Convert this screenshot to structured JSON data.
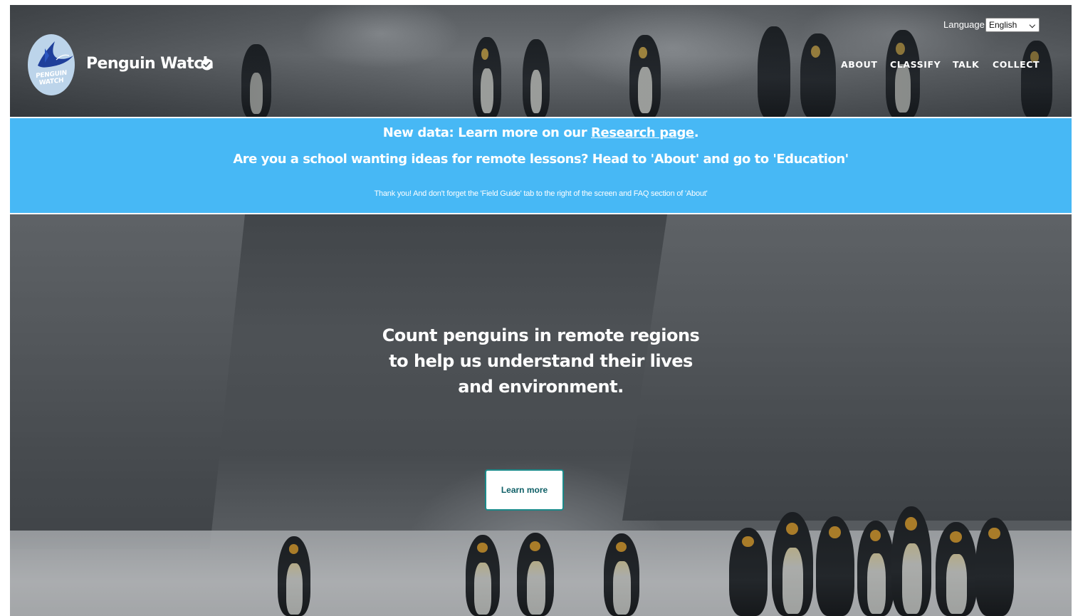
{
  "header": {
    "brand_name": "Penguin Watch",
    "logo_text_line1": "PENGUIN",
    "logo_text_line2": "WATCH",
    "language_label": "Language",
    "language_selected": "English",
    "nav": [
      {
        "label": "ABOUT"
      },
      {
        "label": "CLASSIFY"
      },
      {
        "label": "TALK"
      },
      {
        "label": "COLLECT"
      }
    ]
  },
  "announcement": {
    "line1_prefix": "New data: Learn more on our ",
    "line1_link": "Research page",
    "line1_suffix": ".",
    "line2": "Are you a school wanting ideas for remote lessons? Head to 'About' and go to 'Education'",
    "line3": "Thank you! And don't forget the 'Field Guide' tab to the right of the screen and FAQ section of 'About'"
  },
  "hero": {
    "tagline_line1": "Count penguins in remote regions",
    "tagline_line2": "to help us understand their lives",
    "tagline_line3": "and environment.",
    "button_label": "Learn more"
  },
  "colors": {
    "announcement_bg": "#47b8f5",
    "button_border": "#1b8a8a",
    "logo_bg": "#bcd4ea"
  }
}
